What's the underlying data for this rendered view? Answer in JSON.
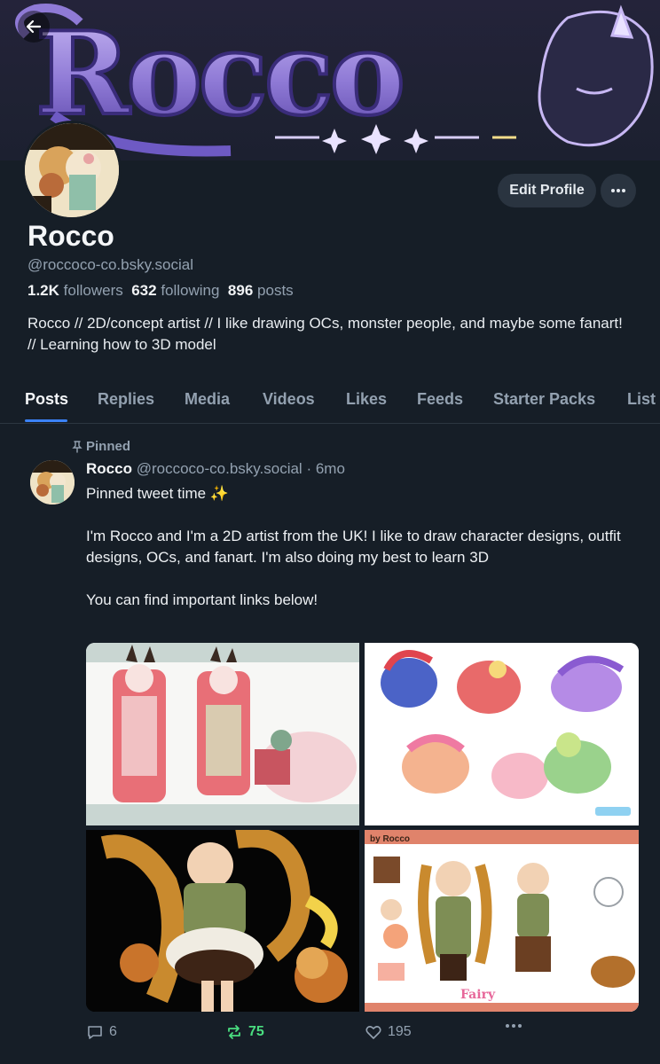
{
  "banner": {
    "logo_text": "Rocco"
  },
  "profile": {
    "display_name": "Rocco",
    "handle": "@roccoco-co.bsky.social",
    "followers_count": "1.2K",
    "followers_label": "followers",
    "following_count": "632",
    "following_label": "following",
    "posts_count": "896",
    "posts_label": "posts",
    "bio": "Rocco // 2D/concept artist // I like drawing OCs, monster people, and maybe some fanart! // Learning how to 3D model",
    "edit_label": "Edit Profile"
  },
  "tabs": [
    {
      "label": "Posts"
    },
    {
      "label": "Replies"
    },
    {
      "label": "Media"
    },
    {
      "label": "Videos"
    },
    {
      "label": "Likes"
    },
    {
      "label": "Feeds"
    },
    {
      "label": "Starter Packs"
    },
    {
      "label": "List"
    }
  ],
  "post": {
    "pinned_label": "Pinned",
    "author": "Rocco",
    "handle": "@roccoco-co.bsky.social",
    "time": "· 6mo",
    "lines": [
      "Pinned tweet time ✨",
      "",
      "I'm Rocco and I'm a 2D artist from the UK! I like to draw character designs, outfit designs, OCs, and fanart. I'm also doing my best to learn 3D",
      "",
      "You can find important links below!"
    ],
    "image4_caption": "by Rocco",
    "replies": "6",
    "reposts": "75",
    "likes": "195"
  },
  "colors": {
    "background": "#161e27",
    "accent": "#3b82f6",
    "repost": "#4ade80",
    "muted": "#93a1b0",
    "logo": "#8f7ad6"
  },
  "icons": [
    "back-arrow-icon",
    "ellipsis-icon",
    "pin-icon",
    "reply-icon",
    "repost-icon",
    "heart-icon"
  ]
}
